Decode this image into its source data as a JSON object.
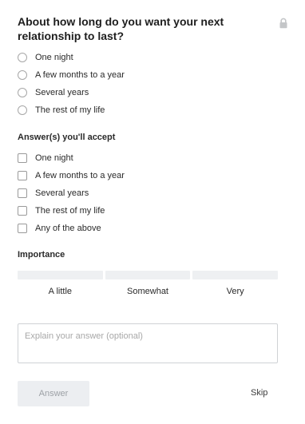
{
  "question": {
    "text": "About how long do you want your next relationship to last?"
  },
  "own_answer": {
    "options": [
      {
        "label": "One night"
      },
      {
        "label": "A few months to a year"
      },
      {
        "label": "Several years"
      },
      {
        "label": "The rest of my life"
      }
    ]
  },
  "accepted": {
    "title": "Answer(s) you'll accept",
    "options": [
      {
        "label": "One night"
      },
      {
        "label": "A few months to a year"
      },
      {
        "label": "Several years"
      },
      {
        "label": "The rest of my life"
      },
      {
        "label": "Any of the above"
      }
    ]
  },
  "importance": {
    "title": "Importance",
    "levels": [
      {
        "label": "A little"
      },
      {
        "label": "Somewhat"
      },
      {
        "label": "Very"
      }
    ]
  },
  "explain": {
    "placeholder": "Explain your answer (optional)",
    "value": ""
  },
  "actions": {
    "answer_label": "Answer",
    "skip_label": "Skip"
  },
  "colors": {
    "disabled_button_bg": "#eceef1",
    "disabled_button_text": "#9da1a6",
    "importance_bar": "#eef0f2"
  },
  "icons": {
    "lock": "lock-icon"
  }
}
